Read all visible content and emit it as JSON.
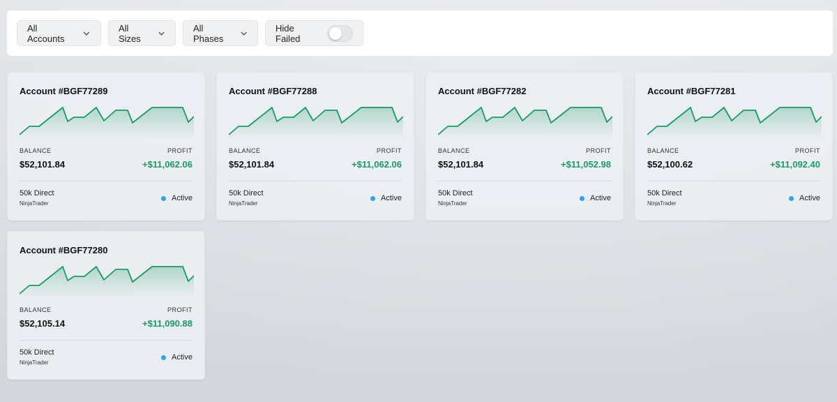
{
  "filters": {
    "accounts_label": "All Accounts",
    "sizes_label": "All Sizes",
    "phases_label": "All Phases",
    "hide_failed_label": "Hide Failed",
    "hide_failed_on": false
  },
  "labels": {
    "balance": "BALANCE",
    "profit": "PROFIT"
  },
  "accent_color": "#1a9a66",
  "status_color": "#2aa6e6",
  "accounts": [
    {
      "title": "Account #BGF77289",
      "balance": "$52,101.84",
      "profit": "+$11,062.06",
      "plan": "50k Direct",
      "platform": "NinjaTrader",
      "status": "Active"
    },
    {
      "title": "Account #BGF77288",
      "balance": "$52,101.84",
      "profit": "+$11,062.06",
      "plan": "50k Direct",
      "platform": "NinjaTrader",
      "status": "Active"
    },
    {
      "title": "Account #BGF77282",
      "balance": "$52,101.84",
      "profit": "+$11,052.98",
      "plan": "50k Direct",
      "platform": "NinjaTrader",
      "status": "Active"
    },
    {
      "title": "Account #BGF77281",
      "balance": "$52,100.62",
      "profit": "+$11,092.40",
      "plan": "50k Direct",
      "platform": "NinjaTrader",
      "status": "Active"
    },
    {
      "title": "Account #BGF77280",
      "balance": "$52,105.14",
      "profit": "+$11,090.88",
      "plan": "50k Direct",
      "platform": "NinjaTrader",
      "status": "Active"
    }
  ]
}
